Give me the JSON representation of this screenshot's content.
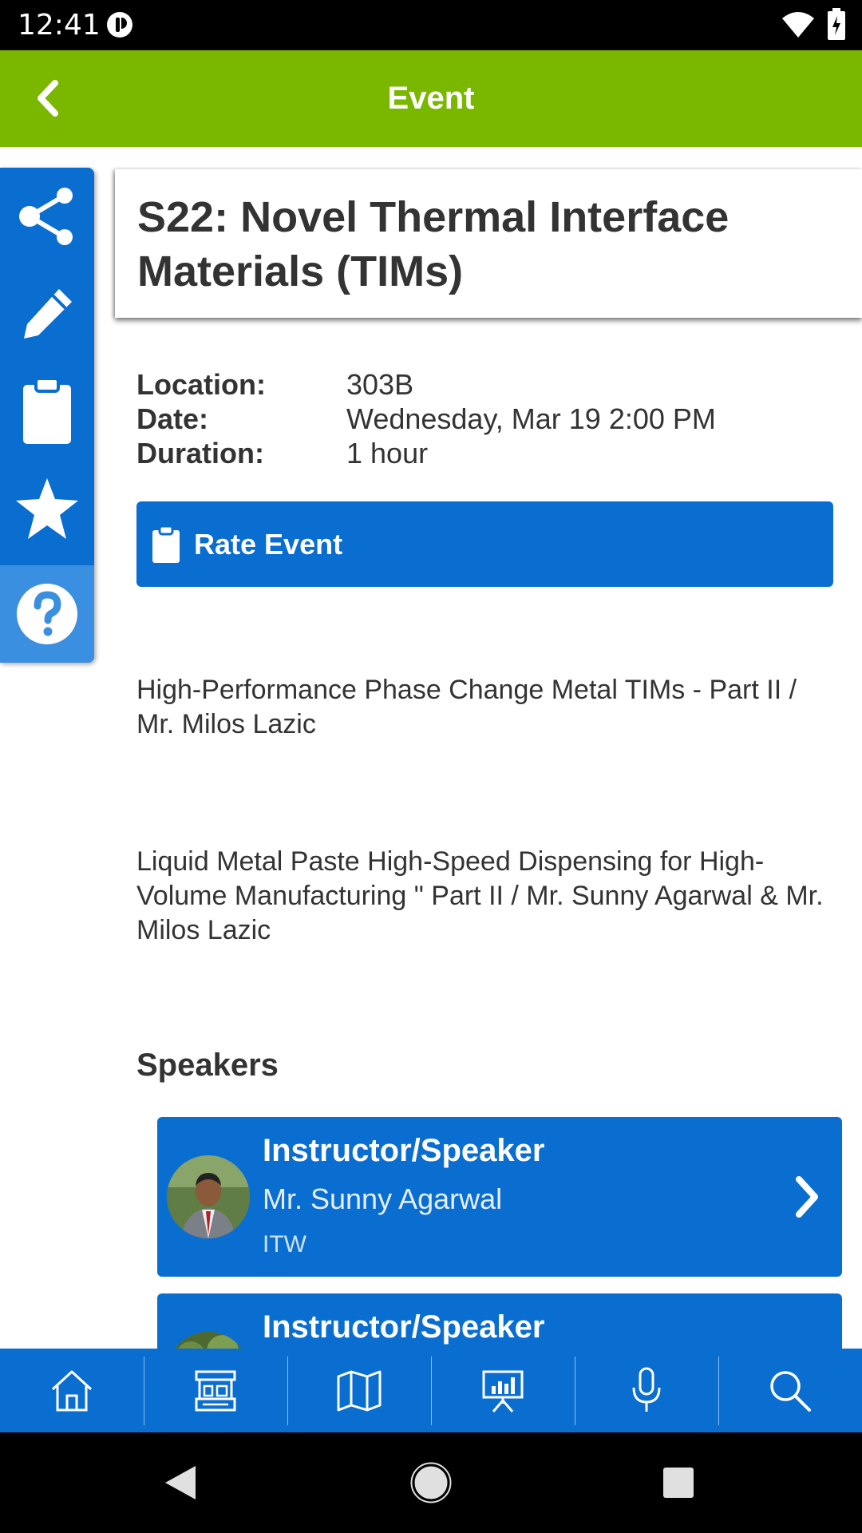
{
  "status_bar": {
    "time": "12:41"
  },
  "app_bar": {
    "title": "Event"
  },
  "side_toolbar": {
    "buttons": [
      "share-icon",
      "edit-icon",
      "clipboard-icon",
      "star-icon",
      "help-icon"
    ]
  },
  "event": {
    "title": "S22: Novel Thermal Interface Materials (TIMs)",
    "details": [
      {
        "label": "Location:",
        "value": "303B"
      },
      {
        "label": "Date:",
        "value": "Wednesday, Mar 19 2:00 PM"
      },
      {
        "label": "Duration:",
        "value": "1 hour"
      }
    ],
    "rate_button_label": "Rate Event",
    "descriptions": [
      "High-Performance Phase Change Metal TIMs - Part II / Mr. Milos Lazic",
      "Liquid Metal Paste High-Speed Dispensing for High-Volume Manufacturing \" Part II / Mr. Sunny Agarwal & Mr. Milos Lazic"
    ]
  },
  "speakers": {
    "heading": "Speakers",
    "items": [
      {
        "role": "Instructor/Speaker",
        "name": "Mr. Sunny Agarwal",
        "org": "ITW"
      },
      {
        "role": "Instructor/Speaker",
        "name": "",
        "org": ""
      }
    ]
  },
  "bottom_nav": {
    "items": [
      "home-icon",
      "exhibitor-booth-icon",
      "map-icon",
      "presentation-icon",
      "microphone-icon",
      "search-icon"
    ]
  },
  "colors": {
    "app_bar": "#7ab800",
    "primary": "#0a6ed1",
    "help_button": "#3b8fe0"
  }
}
